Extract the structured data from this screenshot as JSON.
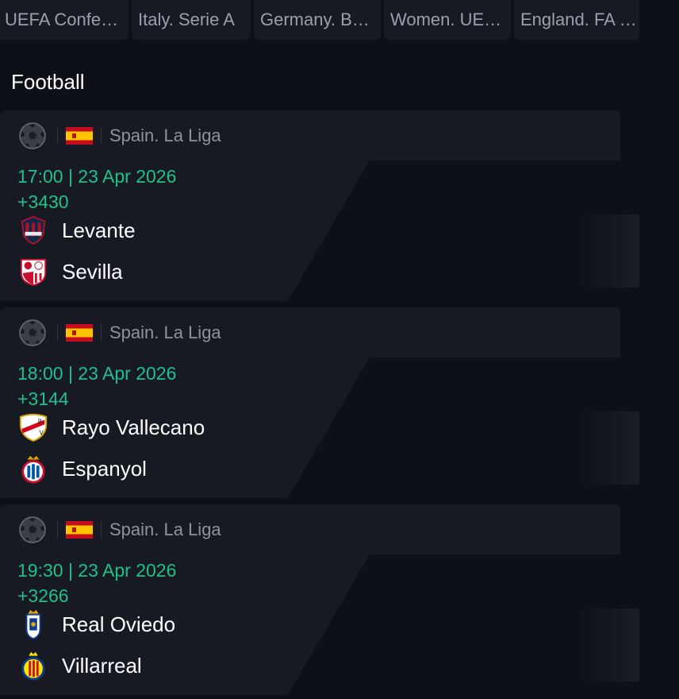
{
  "tabs": [
    {
      "label": "UEFA Confe…"
    },
    {
      "label": "Italy. Serie A"
    },
    {
      "label": "Germany. B…"
    },
    {
      "label": "Women. UE…"
    },
    {
      "label": "England. FA …"
    }
  ],
  "section_title": "Football",
  "matches": [
    {
      "league": "Spain. La Liga",
      "datetime": "17:00 | 23 Apr 2026",
      "markets": "+3430",
      "home": {
        "name": "Levante",
        "logo_icon": "levante-crest-icon"
      },
      "away": {
        "name": "Sevilla",
        "logo_icon": "sevilla-crest-icon"
      }
    },
    {
      "league": "Spain. La Liga",
      "datetime": "18:00 | 23 Apr 2026",
      "markets": "+3144",
      "home": {
        "name": "Rayo Vallecano",
        "logo_icon": "rayo-vallecano-crest-icon"
      },
      "away": {
        "name": "Espanyol",
        "logo_icon": "espanyol-crest-icon"
      }
    },
    {
      "league": "Spain. La Liga",
      "datetime": "19:30 | 23 Apr 2026",
      "markets": "+3266",
      "home": {
        "name": "Real Oviedo",
        "logo_icon": "real-oviedo-crest-icon"
      },
      "away": {
        "name": "Villarreal",
        "logo_icon": "villarreal-crest-icon"
      }
    }
  ],
  "colors": {
    "background": "#0e1017",
    "card": "#171a23",
    "accent_green": "#21c08b",
    "muted_text": "#8d929d",
    "spain_red": "#c60b1e",
    "spain_yellow": "#ffc400"
  }
}
